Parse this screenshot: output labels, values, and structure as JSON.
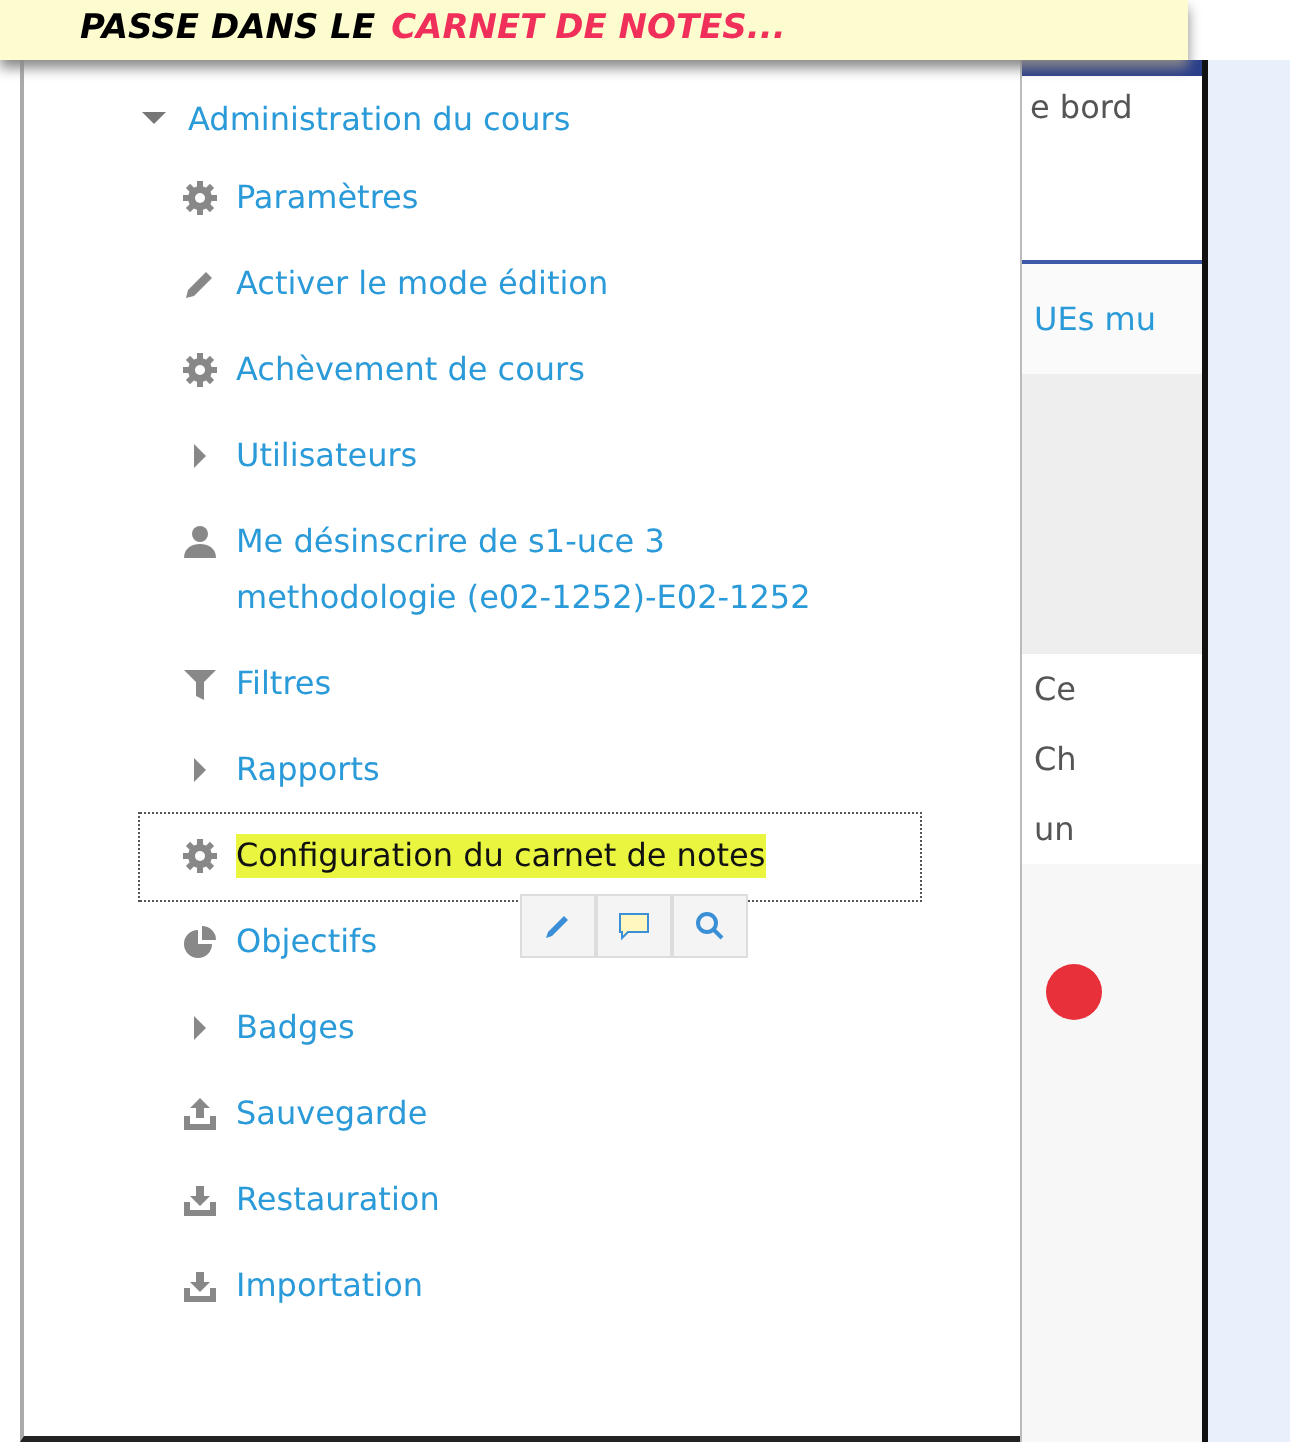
{
  "banner": {
    "lead": "PASSE DANS LE",
    "highlight": "CARNET DE NOTES..."
  },
  "menu": {
    "title": "Administration du cours",
    "expanded": true,
    "items": [
      {
        "label": "Paramètres",
        "kind": "setting",
        "highlighted": false
      },
      {
        "label": "Activer le mode édition",
        "kind": "edit",
        "highlighted": false
      },
      {
        "label": "Achèvement de cours",
        "kind": "setting",
        "highlighted": false
      },
      {
        "label": "Utilisateurs",
        "kind": "folder",
        "highlighted": false
      },
      {
        "label": "Me désinscrire de s1-uce 3 methodologie (e02-1252)-E02-1252",
        "kind": "user",
        "highlighted": false
      },
      {
        "label": "Filtres",
        "kind": "filter",
        "highlighted": false
      },
      {
        "label": "Rapports",
        "kind": "folder",
        "highlighted": false
      },
      {
        "label": "Configuration du carnet de notes",
        "kind": "setting",
        "highlighted": true
      },
      {
        "label": "Objectifs",
        "kind": "outcome",
        "highlighted": false
      },
      {
        "label": "Badges",
        "kind": "folder",
        "highlighted": false
      },
      {
        "label": "Sauvegarde",
        "kind": "backup",
        "highlighted": false
      },
      {
        "label": "Restauration",
        "kind": "restore",
        "highlighted": false
      },
      {
        "label": "Importation",
        "kind": "restore",
        "highlighted": false
      }
    ]
  },
  "side": {
    "heading": "e bord",
    "link": "UEs mu",
    "lines": [
      "Ce",
      "Ch",
      "un"
    ]
  }
}
